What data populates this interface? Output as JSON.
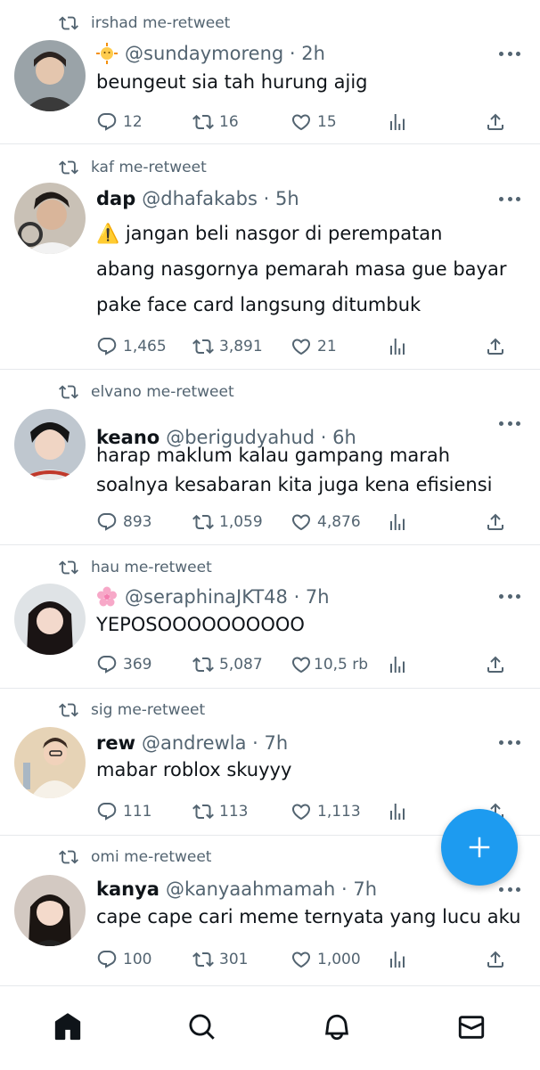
{
  "colors": {
    "accent": "#1d9bf0",
    "text": "#0f1419",
    "muted": "#536471",
    "divider": "#e6e9ec"
  },
  "tweets": [
    {
      "retweeted_by": "irshad me-retweet",
      "display_name": "",
      "emoji": "sun-emoji",
      "handle_time": "@sundaymoreng · 2h",
      "text": "beungeut sia tah hurung ajig",
      "replies": "12",
      "retweets": "16",
      "likes": "15"
    },
    {
      "retweeted_by": "kaf me-retweet",
      "display_name": "dap",
      "handle_time": "@dhafakabs · 5h",
      "text": "⚠️ jangan beli nasgor di perempatan\nabang nasgornya pemarah masa gue bayar\npake face card langsung ditumbuk",
      "replies": "1,465",
      "retweets": "3,891",
      "likes": "21"
    },
    {
      "retweeted_by": "elvano me-retweet",
      "display_name": "keano",
      "handle_time": "@berigudyahud · 6h",
      "text": "harap maklum kalau gampang marah\nsoalnya kesabaran kita juga kena efisiensi",
      "replies": "893",
      "retweets": "1,059",
      "likes": "4,876"
    },
    {
      "retweeted_by": "hau me-retweet",
      "display_name": "",
      "emoji": "cherry-blossom-emoji",
      "handle_time": "@seraphinaJKT48 · 7h",
      "text": "YEPOSOOOOOOOOOO",
      "replies": "369",
      "retweets": "5,087",
      "likes": "10,5 rb"
    },
    {
      "retweeted_by": "sig me-retweet",
      "display_name": "rew",
      "handle_time": "@andrewla · 7h",
      "text": "mabar roblox skuyyy",
      "replies": "111",
      "retweets": "113",
      "likes": "1,113"
    },
    {
      "retweeted_by": "omi me-retweet",
      "display_name": "kanya",
      "handle_time": "@kanyaahmamah · 7h",
      "text": "cape cape cari meme ternyata yang lucu aku",
      "replies": "100",
      "retweets": "301",
      "likes": "1,000"
    }
  ],
  "nav": [
    "home-icon",
    "search-icon",
    "notifications-icon",
    "messages-icon"
  ]
}
